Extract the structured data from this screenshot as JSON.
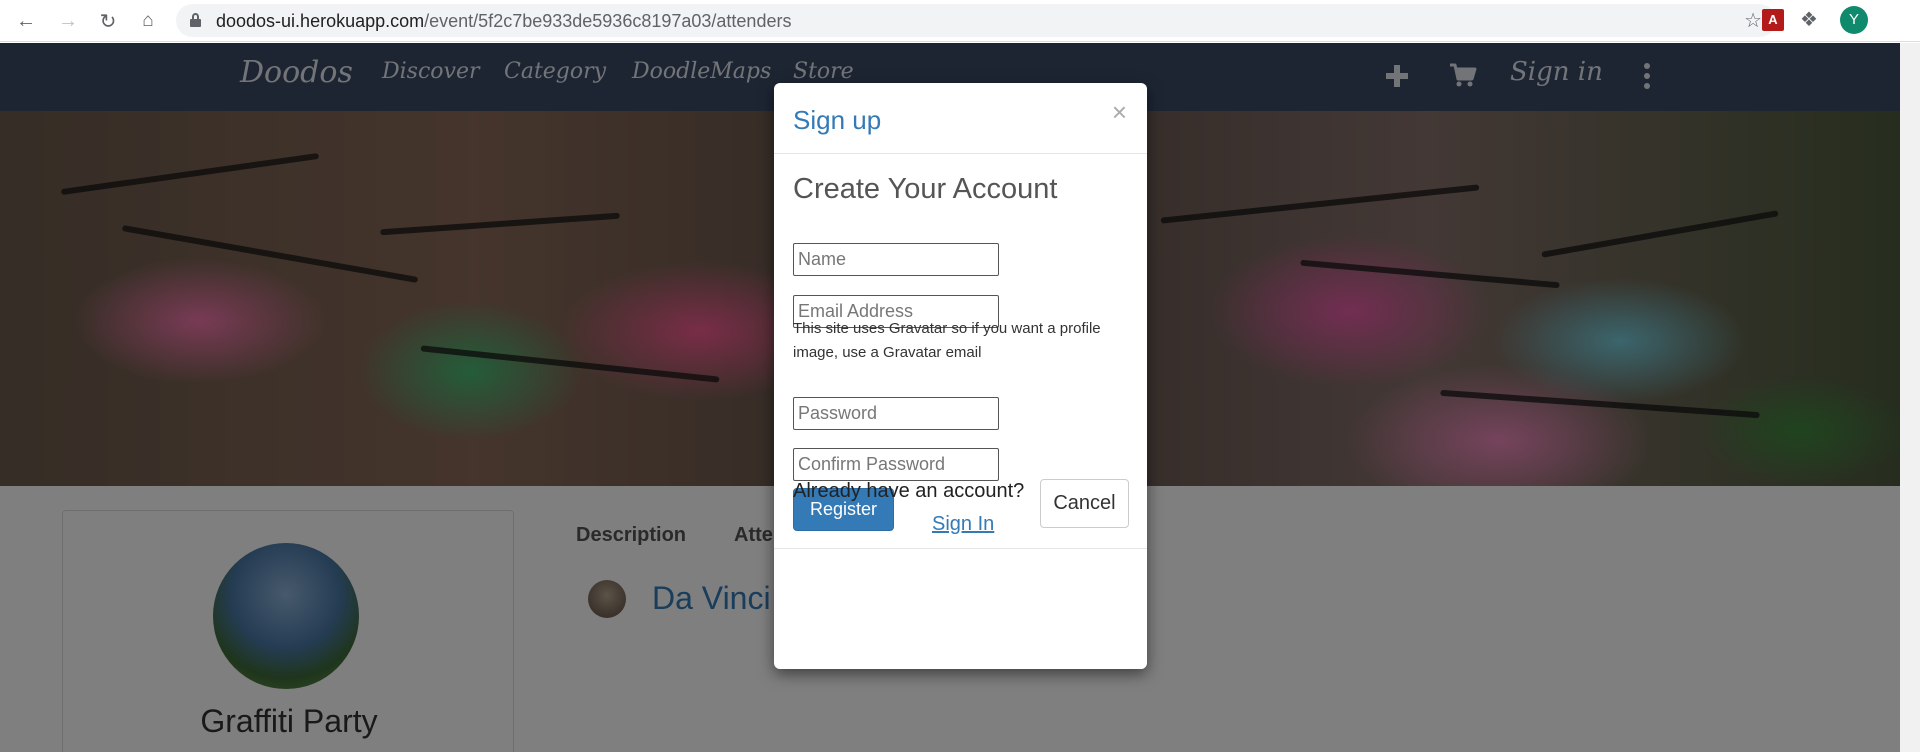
{
  "browser": {
    "url_host": "doodos-ui.herokuapp.com",
    "url_path": "/event/5f2c7be933de5936c8197a03/attenders",
    "profile_initial": "Y",
    "pdf_ext_label": "A"
  },
  "site_nav": {
    "brand": "Doodos",
    "items": [
      "Discover",
      "Category",
      "DoodleMaps",
      "Store"
    ],
    "sign_in": "Sign in"
  },
  "event": {
    "title": "Graffiti Party",
    "tabs": [
      "Description",
      "Atte"
    ],
    "attender_name": "Da Vinci"
  },
  "modal": {
    "title": "Sign up",
    "close": "×",
    "heading": "Create Your Account",
    "name_placeholder": "Name",
    "email_placeholder": "Email Address",
    "help_text": "This site uses Gravatar so if you want a profile image, use a Gravatar email",
    "password_placeholder": "Password",
    "confirm_placeholder": "Confirm Password",
    "register_label": "Register",
    "have_account": "Already have an account?",
    "sign_in_link": "Sign In",
    "cancel_label": "Cancel"
  },
  "colors": {
    "nav_bg": "#3b4a66",
    "primary": "#337ab7",
    "overlay": "rgba(0,0,0,0.5)"
  }
}
